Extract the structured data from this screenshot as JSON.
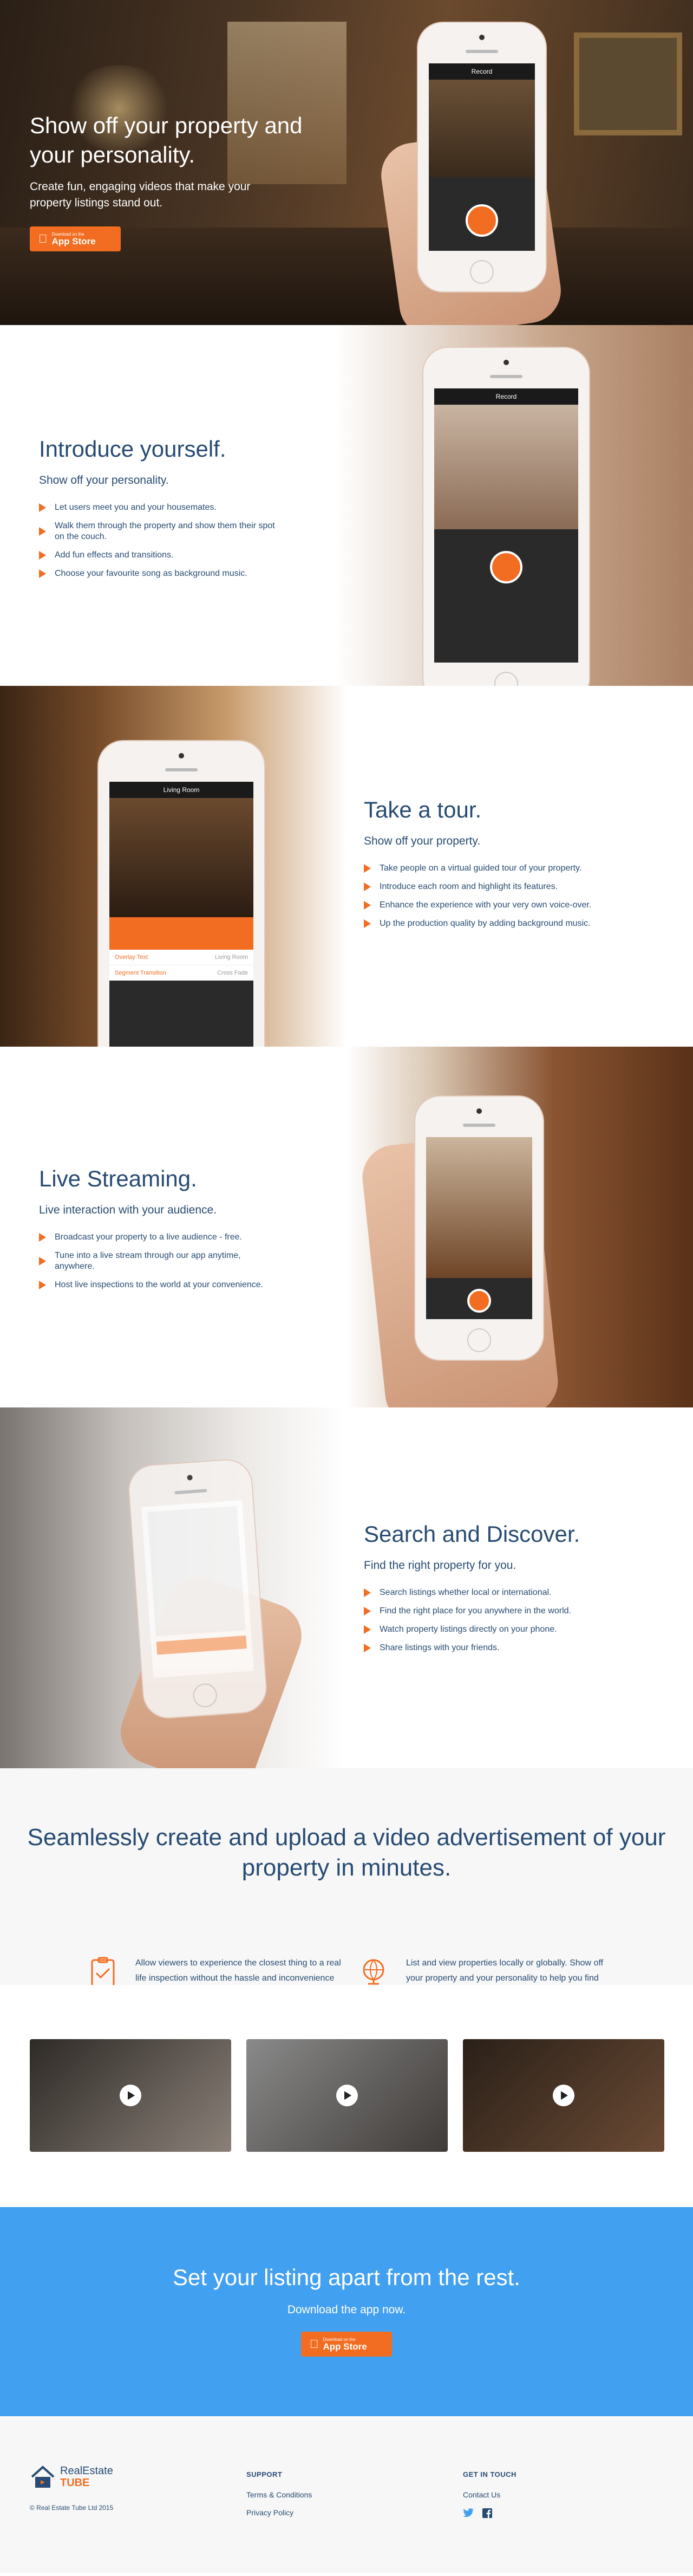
{
  "hero": {
    "title": "Show off your property and your personality.",
    "subtitle": "Create fun, engaging videos that make your property listings stand out.",
    "phone_title": "Record"
  },
  "app_store": {
    "small": "Download on the",
    "big": "App Store"
  },
  "sections": [
    {
      "title": "Introduce yourself.",
      "subtitle": "Show off your personality.",
      "phone_title": "Record",
      "items": [
        "Let users meet you and your housemates.",
        "Walk them through the property and show them their spot on the couch.",
        "Add fun effects and transitions.",
        "Choose your favourite song as background music."
      ]
    },
    {
      "title": "Take a tour.",
      "subtitle": "Show off your property.",
      "phone_title": "Living Room",
      "phone_rows": [
        "Overlay Text",
        "Living Room",
        "Segment Transition",
        "Cross Fade"
      ],
      "items": [
        "Take people on a virtual guided tour of your property.",
        "Introduce each room and highlight its features.",
        "Enhance the experience with your very own voice-over.",
        "Up the production quality by adding background music."
      ]
    },
    {
      "title": "Live Streaming.",
      "subtitle": "Live interaction with your audience.",
      "items": [
        "Broadcast your property to a live audience - free.",
        "Tune into a live stream through our app anytime, anywhere.",
        "Host live inspections to the world at your convenience."
      ]
    },
    {
      "title": "Search and Discover.",
      "subtitle": "Find the right property for you.",
      "items": [
        "Search listings whether local or international.",
        "Find the right place for you anywhere in the world.",
        "Watch property listings directly on your phone.",
        "Share listings with your friends."
      ]
    }
  ],
  "upload": {
    "title": "Seamlessly create and upload a video advertisement of your property in minutes.",
    "features": [
      {
        "icon": "clipboard-icon",
        "text": "Allow viewers to experience the closest thing to a real life inspection without the hassle and inconvenience of having to be there."
      },
      {
        "icon": "globe-icon",
        "text": "List and view properties locally or globally. Show off your property and your personality to help you find the right housemate."
      }
    ]
  },
  "cta": {
    "title": "Set your listing apart from the rest.",
    "subtitle": "Download the app now."
  },
  "footer": {
    "logo_top": "RealEstate",
    "logo_bottom": "TUBE",
    "copyright": "© Real Estate Tube Ltd 2015",
    "support_heading": "SUPPORT",
    "support_links": [
      "Terms & Conditions",
      "Privacy Policy"
    ],
    "contact_heading": "GET IN TOUCH",
    "contact_links": [
      "Contact Us"
    ],
    "social": [
      "twitter-icon",
      "facebook-icon"
    ]
  },
  "colors": {
    "accent": "#f26d21",
    "navy": "#274b73",
    "cta_blue": "#42a0f0"
  }
}
